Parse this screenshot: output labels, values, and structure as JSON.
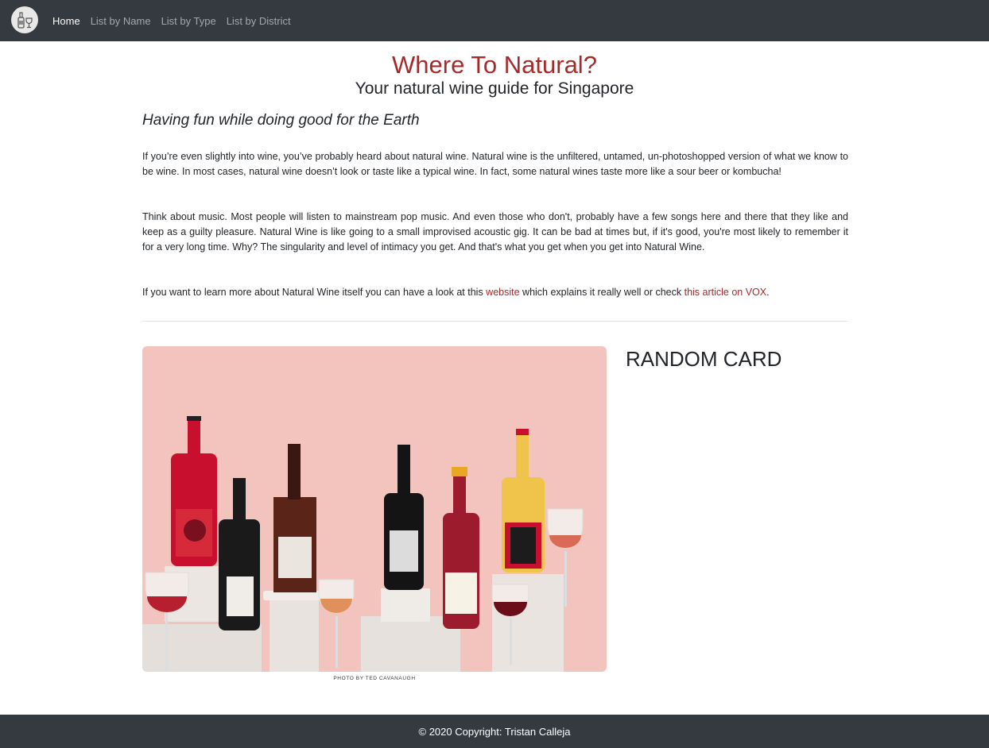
{
  "nav": {
    "brand_icon": "wine-bottle-glass-logo",
    "links": [
      {
        "label": "Home",
        "active": true
      },
      {
        "label": "List by Name",
        "active": false
      },
      {
        "label": "List by Type",
        "active": false
      },
      {
        "label": "List by District",
        "active": false
      }
    ]
  },
  "header": {
    "title": "Where To Natural?",
    "subtitle": "Your natural wine guide for Singapore"
  },
  "intro": {
    "tagline": "Having fun while doing good for the Earth",
    "p1": "If you’re even slightly into wine, you’ve probably heard about natural wine. Natural wine is the unfiltered, untamed, un-photoshopped version of what we know to be wine. In most cases, natural wine doesn’t look or taste like a typical wine. In fact, some natural wines taste more like a sour beer or kombucha!",
    "p2": "Think about music. Most people will listen to mainstream pop music. And even those who don't, probably have a few songs here and there that they like and keep as a guilty pleasure. Natural Wine is like going to a small improvised acoustic gig. It can be bad at times but, if it's good, you're most likely to remember it for a very long time. Why? The singularity and level of intimacy you get. And that's what you get when you get into Natural Wine.",
    "p3_before": "If you want to learn more about Natural Wine itself you can have a look at this ",
    "p3_link1": "website",
    "p3_middle": " which explains it really well or check ",
    "p3_link2": "this article on VOX",
    "p3_after": "."
  },
  "photo": {
    "caption": "PHOTO BY TED CAVANAUGH"
  },
  "random_card": {
    "heading": "RANDOM CARD"
  },
  "footer": {
    "text": "© 2020 Copyright: Tristan Calleja"
  },
  "colors": {
    "navbar_bg": "#343a40",
    "accent": "#a52a2a",
    "photo_bg": "#f2c4bd"
  }
}
